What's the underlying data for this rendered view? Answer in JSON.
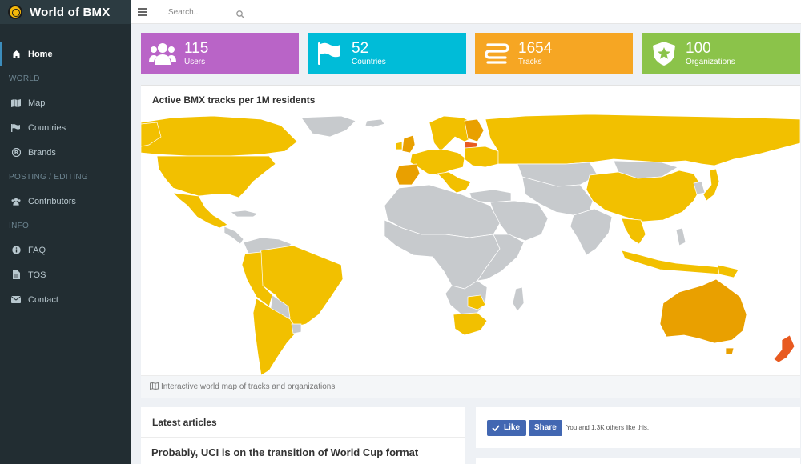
{
  "app": {
    "title": "World of BMX"
  },
  "search": {
    "placeholder": "Search..."
  },
  "sidebar": {
    "home": "Home",
    "sections": [
      {
        "header": "WORLD",
        "items": [
          "Map",
          "Countries",
          "Brands"
        ]
      },
      {
        "header": "POSTING / EDITING",
        "items": [
          "Contributors"
        ]
      },
      {
        "header": "INFO",
        "items": [
          "FAQ",
          "TOS",
          "Contact"
        ]
      }
    ]
  },
  "stats": [
    {
      "value": "115",
      "label": "Users",
      "color": "#b964c7",
      "icon": "users-icon"
    },
    {
      "value": "52",
      "label": "Countries",
      "color": "#00bcd8",
      "icon": "flag-icon"
    },
    {
      "value": "1654",
      "label": "Tracks",
      "color": "#f6a623",
      "icon": "road-icon"
    },
    {
      "value": "100",
      "label": "Organizations",
      "color": "#8bc34a",
      "icon": "badge-star-icon"
    }
  ],
  "map": {
    "title": "Active BMX tracks per 1M residents",
    "footer": "Interactive world map of tracks and organizations",
    "colors": {
      "active": "#f2c000",
      "high": "#e9a000",
      "highest": "#e85a20",
      "none": "#c7cacd"
    }
  },
  "articles": {
    "title": "Latest articles",
    "items": [
      "Probably, UCI is on the transition of World Cup format"
    ]
  },
  "social": {
    "like": "Like",
    "share": "Share",
    "text": "You and 1.3K others like this."
  }
}
